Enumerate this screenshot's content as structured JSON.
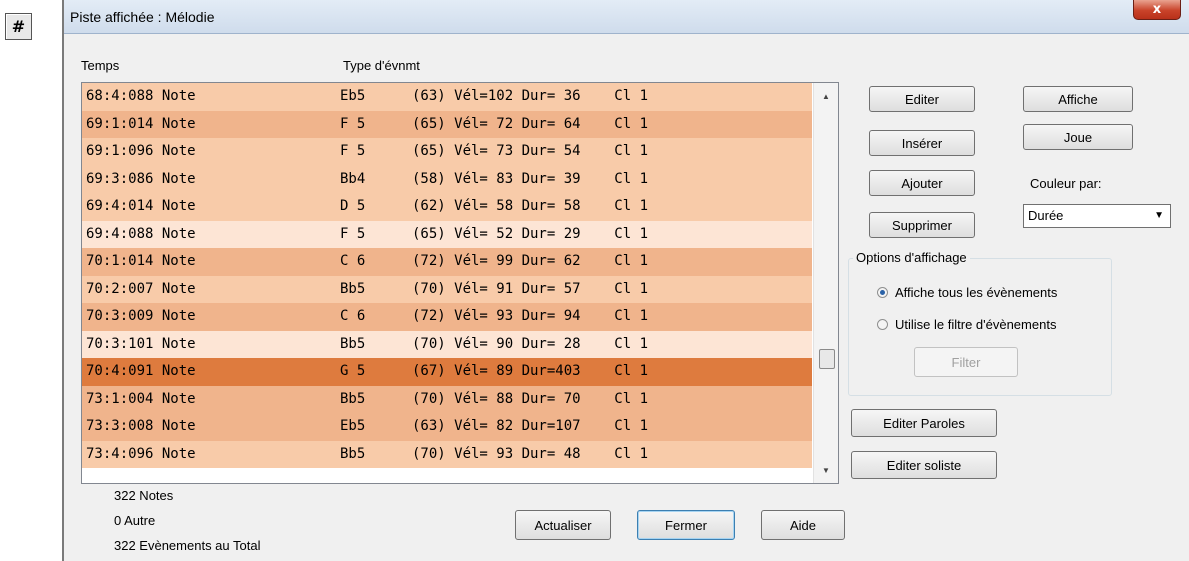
{
  "app_icon": "#",
  "window": {
    "title": "Piste affichée : Mélodie",
    "close_glyph": "x"
  },
  "columns": {
    "time": "Temps",
    "type": "Type d'évnmt"
  },
  "events": [
    {
      "time": "68:4:088 Note",
      "note": "Eb5",
      "detail": "(63) Vél=102 Dur= 36    Cl 1",
      "color": "#f8cba9"
    },
    {
      "time": "69:1:014 Note",
      "note": "F 5",
      "detail": "(65) Vél= 72 Dur= 64    Cl 1",
      "color": "#f0b48c"
    },
    {
      "time": "69:1:096 Note",
      "note": "F 5",
      "detail": "(65) Vél= 73 Dur= 54    Cl 1",
      "color": "#f8cba9"
    },
    {
      "time": "69:3:086 Note",
      "note": "Bb4",
      "detail": "(58) Vél= 83 Dur= 39    Cl 1",
      "color": "#f8cba9"
    },
    {
      "time": "69:4:014 Note",
      "note": "D 5",
      "detail": "(62) Vél= 58 Dur= 58    Cl 1",
      "color": "#f8cba9"
    },
    {
      "time": "69:4:088 Note",
      "note": "F 5",
      "detail": "(65) Vél= 52 Dur= 29    Cl 1",
      "color": "#fde5d5"
    },
    {
      "time": "70:1:014 Note",
      "note": "C 6",
      "detail": "(72) Vél= 99 Dur= 62    Cl 1",
      "color": "#f0b48c"
    },
    {
      "time": "70:2:007 Note",
      "note": "Bb5",
      "detail": "(70) Vél= 91 Dur= 57    Cl 1",
      "color": "#f8cba9"
    },
    {
      "time": "70:3:009 Note",
      "note": "C 6",
      "detail": "(72) Vél= 93 Dur= 94    Cl 1",
      "color": "#f0b48c"
    },
    {
      "time": "70:3:101 Note",
      "note": "Bb5",
      "detail": "(70) Vél= 90 Dur= 28    Cl 1",
      "color": "#fde5d5"
    },
    {
      "time": "70:4:091 Note",
      "note": "G 5",
      "detail": "(67) Vél= 89 Dur=403    Cl 1",
      "color": "#de7b3e"
    },
    {
      "time": "73:1:004 Note",
      "note": "Bb5",
      "detail": "(70) Vél= 88 Dur= 70    Cl 1",
      "color": "#f0b48c"
    },
    {
      "time": "73:3:008 Note",
      "note": "Eb5",
      "detail": "(63) Vél= 82 Dur=107    Cl 1",
      "color": "#f0b48c"
    },
    {
      "time": "73:4:096 Note",
      "note": "Bb5",
      "detail": "(70) Vél= 93 Dur= 48    Cl 1",
      "color": "#f8cba9"
    }
  ],
  "buttons": {
    "editer": "Editer",
    "affiche": "Affiche",
    "inserer": "Insérer",
    "joue": "Joue",
    "ajouter": "Ajouter",
    "supprimer": "Supprimer",
    "editer_paroles": "Editer Paroles",
    "editer_soliste": "Editer soliste",
    "actualiser": "Actualiser",
    "fermer": "Fermer",
    "aide": "Aide",
    "filter": "Filter"
  },
  "color_by": {
    "label": "Couleur par:",
    "value": "Durée"
  },
  "display_options": {
    "legend": "Options d'affichage",
    "option_all": "Affiche tous les évènements",
    "option_filter": "Utilise le filtre d'évènements",
    "selected": "all"
  },
  "status": {
    "notes": "322 Notes",
    "other": "0 Autre",
    "total": "322 Evènements au Total"
  }
}
